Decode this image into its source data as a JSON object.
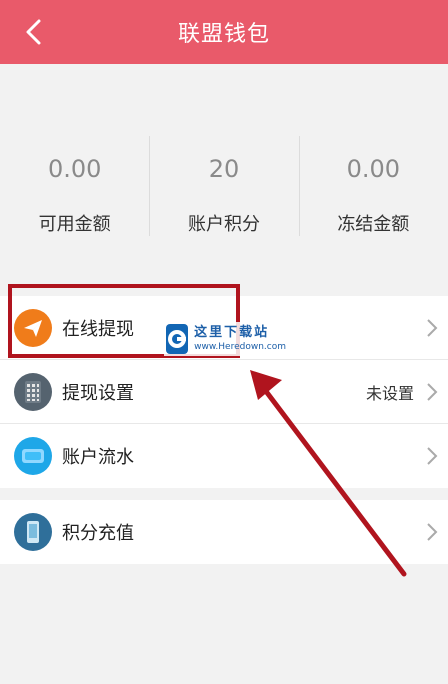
{
  "header": {
    "title": "联盟钱包",
    "back_icon": "chevron-left-icon"
  },
  "stats": [
    {
      "value": "0.00",
      "label": "可用金额"
    },
    {
      "value": "20",
      "label": "账户积分"
    },
    {
      "value": "0.00",
      "label": "冻结金额"
    }
  ],
  "menu": [
    {
      "label": "在线提现",
      "icon": "paper-plane-icon",
      "value": ""
    },
    {
      "label": "提现设置",
      "icon": "calculator-icon",
      "value": "未设置"
    },
    {
      "label": "账户流水",
      "icon": "card-icon",
      "value": ""
    },
    {
      "label": "积分充值",
      "icon": "phone-icon",
      "value": ""
    }
  ],
  "watermark": {
    "cn": "这里下载站",
    "en": "www.Heredown.com"
  },
  "colors": {
    "header": "#e95a6a",
    "highlight": "#b0141e",
    "arrow": "#b0141e"
  }
}
